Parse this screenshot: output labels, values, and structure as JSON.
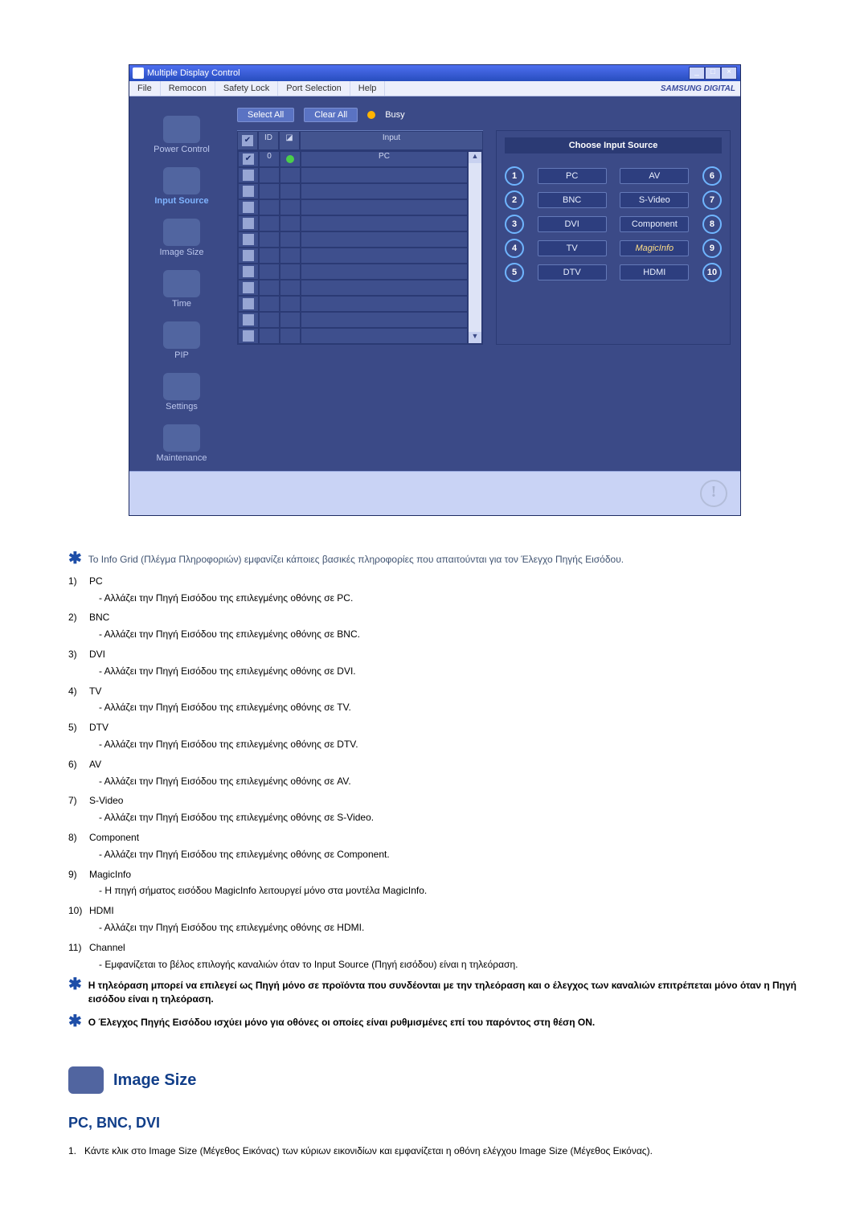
{
  "window": {
    "title": "Multiple Display Control",
    "menu": [
      "File",
      "Remocon",
      "Safety Lock",
      "Port Selection",
      "Help"
    ],
    "brand": "SAMSUNG DIGITAL"
  },
  "sidebar": {
    "items": [
      {
        "label": "Power Control",
        "selected": false
      },
      {
        "label": "Input Source",
        "selected": true
      },
      {
        "label": "Image Size",
        "selected": false
      },
      {
        "label": "Time",
        "selected": false
      },
      {
        "label": "PIP",
        "selected": false
      },
      {
        "label": "Settings",
        "selected": false
      },
      {
        "label": "Maintenance",
        "selected": false
      }
    ]
  },
  "toolbar": {
    "select_all": "Select All",
    "clear_all": "Clear All",
    "busy": "Busy"
  },
  "grid": {
    "headers": {
      "id": "ID",
      "input": "Input"
    },
    "first_row": {
      "id": "0",
      "input": "PC"
    },
    "blank_rows": 11
  },
  "right_panel": {
    "title": "Choose Input Source",
    "left_col": [
      {
        "num": "1",
        "label": "PC"
      },
      {
        "num": "2",
        "label": "BNC"
      },
      {
        "num": "3",
        "label": "DVI"
      },
      {
        "num": "4",
        "label": "TV"
      },
      {
        "num": "5",
        "label": "DTV"
      }
    ],
    "right_col": [
      {
        "num": "6",
        "label": "AV"
      },
      {
        "num": "7",
        "label": "S-Video"
      },
      {
        "num": "8",
        "label": "Component"
      },
      {
        "num": "9",
        "label": "MagicInfo",
        "mi": true
      },
      {
        "num": "10",
        "label": "HDMI"
      }
    ]
  },
  "notes": {
    "star_intro": "Το Info Grid (Πλέγμα Πληροφοριών) εμφανίζει κάποιες βασικές πληροφορίες που απαιτούνται για τον Έλεγχο Πηγής Εισόδου.",
    "items": [
      {
        "num": "1)",
        "title": "PC",
        "desc": "- Αλλάζει την Πηγή Εισόδου της επιλεγμένης οθόνης σε PC."
      },
      {
        "num": "2)",
        "title": "BNC",
        "desc": "- Αλλάζει την Πηγή Εισόδου της επιλεγμένης οθόνης σε BNC."
      },
      {
        "num": "3)",
        "title": "DVI",
        "desc": "- Αλλάζει την Πηγή Εισόδου της επιλεγμένης οθόνης σε DVI."
      },
      {
        "num": "4)",
        "title": "TV",
        "desc": "- Αλλάζει την Πηγή Εισόδου της επιλεγμένης οθόνης σε TV."
      },
      {
        "num": "5)",
        "title": "DTV",
        "desc": "- Αλλάζει την Πηγή Εισόδου της επιλεγμένης οθόνης σε DTV."
      },
      {
        "num": "6)",
        "title": "AV",
        "desc": "- Αλλάζει την Πηγή Εισόδου της επιλεγμένης οθόνης σε AV."
      },
      {
        "num": "7)",
        "title": "S-Video",
        "desc": "- Αλλάζει την Πηγή Εισόδου της επιλεγμένης οθόνης σε S-Video."
      },
      {
        "num": "8)",
        "title": "Component",
        "desc": "- Αλλάζει την Πηγή Εισόδου της επιλεγμένης οθόνης σε Component."
      },
      {
        "num": "9)",
        "title": "MagicInfo",
        "desc": "- Η πηγή σήματος εισόδου MagicInfo λειτουργεί μόνο στα μοντέλα MagicInfo."
      },
      {
        "num": "10)",
        "title": "HDMI",
        "desc": "- Αλλάζει την Πηγή Εισόδου της επιλεγμένης οθόνης σε HDMI."
      },
      {
        "num": "11)",
        "title": "Channel",
        "desc": "- Εμφανίζεται το βέλος επιλογής καναλιών όταν το Input Source (Πηγή εισόδου) είναι η τηλεόραση."
      }
    ],
    "star_tv": "Η τηλεόραση μπορεί να επιλεγεί ως Πηγή μόνο σε προϊόντα που συνδέονται με την τηλεόραση και ο έλεγχος των καναλιών επιτρέπεται μόνο όταν η Πηγή εισόδου είναι η τηλεόραση.",
    "star_on": "Ο Έλεγχος Πηγής Εισόδου ισχύει μόνο για οθόνες οι οποίες είναι ρυθμισμένες επί του παρόντος στη θέση ON."
  },
  "section": {
    "title": "Image Size",
    "subtitle": "PC, BNC, DVI",
    "ol1_num": "1.",
    "ol1": "Κάντε κλικ στο Image Size (Μέγεθος Εικόνας) των κύριων εικονιδίων και εμφανίζεται η οθόνη ελέγχου Image Size (Μέγεθος Εικόνας)."
  }
}
